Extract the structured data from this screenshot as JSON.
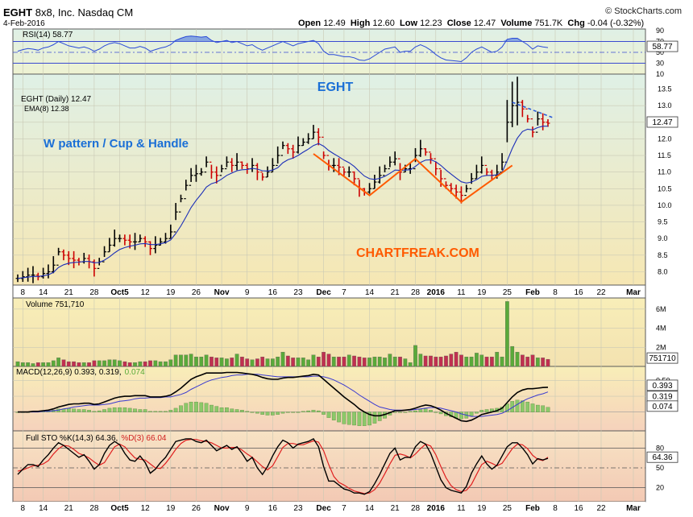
{
  "header": {
    "symbol": "EGHT",
    "company": "8x8, Inc.",
    "exchange": "Nasdaq CM",
    "date": "4-Feb-2016",
    "brand": "© StockCharts.com",
    "open_label": "Open",
    "open": "12.49",
    "high_label": "High",
    "high": "12.60",
    "low_label": "Low",
    "low": "12.23",
    "close_label": "Close",
    "close": "12.47",
    "volume_label": "Volume",
    "volume": "751.7K",
    "chg_label": "Chg",
    "chg": "-0.04 (-0.32%)"
  },
  "colors": {
    "up_bar": "#000000",
    "down_bar": "#cc0000",
    "ema": "#1c2fb8",
    "title_blue": "#1a6fd6",
    "annotation_orange": "#ff5a00",
    "volume_up": "#5aaa3a",
    "volume_down": "#c03050",
    "rsi_line": "#2a4ad8"
  },
  "x_axis_labels": [
    "8",
    "14",
    "21",
    "28",
    "Oct5",
    "12",
    "19",
    "26",
    "Nov",
    "9",
    "16",
    "23",
    "Dec",
    "7",
    "14",
    "21",
    "28",
    "2016",
    "11",
    "19",
    "25",
    "Feb",
    "8",
    "16",
    "22",
    "Mar"
  ],
  "annotations": {
    "chart_title": "EGHT",
    "pattern": "W pattern / Cup & Handle",
    "watermark": "CHARTFREAK.COM"
  },
  "panels": {
    "rsi": {
      "label": "RSI(14) 58.77",
      "value_tag": "58.77",
      "ticks": [
        "90",
        "70",
        "50",
        "30",
        "10"
      ]
    },
    "price": {
      "label": "EGHT (Daily) 12.47",
      "ema_label": "EMA(8) 12.38",
      "value_tag": "12.47",
      "ticks": [
        "13.5",
        "13.0",
        "12.5",
        "12.0",
        "11.5",
        "11.0",
        "10.5",
        "10.0",
        "9.5",
        "9.0",
        "8.5",
        "8.0"
      ]
    },
    "volume": {
      "label": "Volume 751,710",
      "value_tag": "751710",
      "ticks": [
        "6M",
        "4M",
        "2M"
      ]
    },
    "macd": {
      "label_main": "MACD(12,26,9) 0.393, 0.319,",
      "label_hist": "0.074",
      "tag1": "0.393",
      "tag2": "0.319",
      "tag3": "0.074",
      "ticks": [
        "0.50",
        "0.25"
      ]
    },
    "sto": {
      "label_k": "Full STO %K(14,3) 64.36,",
      "label_d": "%D(3) 66.04",
      "value_tag": "64.36",
      "ticks": [
        "80",
        "50",
        "20"
      ]
    }
  },
  "chart_data": {
    "type": "candlestick",
    "dates": [
      "2015-09-04",
      "2015-09-08",
      "2015-09-09",
      "2015-09-10",
      "2015-09-11",
      "2015-09-14",
      "2015-09-15",
      "2015-09-16",
      "2015-09-17",
      "2015-09-18",
      "2015-09-21",
      "2015-09-22",
      "2015-09-23",
      "2015-09-24",
      "2015-09-25",
      "2015-09-28",
      "2015-09-29",
      "2015-09-30",
      "2015-10-01",
      "2015-10-02",
      "2015-10-05",
      "2015-10-06",
      "2015-10-07",
      "2015-10-08",
      "2015-10-09",
      "2015-10-12",
      "2015-10-13",
      "2015-10-14",
      "2015-10-15",
      "2015-10-16",
      "2015-10-19",
      "2015-10-20",
      "2015-10-21",
      "2015-10-22",
      "2015-10-23",
      "2015-10-26",
      "2015-10-27",
      "2015-10-28",
      "2015-10-29",
      "2015-10-30",
      "2015-11-02",
      "2015-11-03",
      "2015-11-04",
      "2015-11-05",
      "2015-11-06",
      "2015-11-09",
      "2015-11-10",
      "2015-11-11",
      "2015-11-12",
      "2015-11-13",
      "2015-11-16",
      "2015-11-17",
      "2015-11-18",
      "2015-11-19",
      "2015-11-20",
      "2015-11-23",
      "2015-11-24",
      "2015-11-25",
      "2015-11-27",
      "2015-11-30",
      "2015-12-01",
      "2015-12-02",
      "2015-12-03",
      "2015-12-04",
      "2015-12-07",
      "2015-12-08",
      "2015-12-09",
      "2015-12-10",
      "2015-12-11",
      "2015-12-14",
      "2015-12-15",
      "2015-12-16",
      "2015-12-17",
      "2015-12-18",
      "2015-12-21",
      "2015-12-22",
      "2015-12-23",
      "2015-12-24",
      "2015-12-28",
      "2015-12-29",
      "2015-12-30",
      "2015-12-31",
      "2016-01-04",
      "2016-01-05",
      "2016-01-06",
      "2016-01-07",
      "2016-01-08",
      "2016-01-11",
      "2016-01-12",
      "2016-01-13",
      "2016-01-14",
      "2016-01-15",
      "2016-01-19",
      "2016-01-20",
      "2016-01-21",
      "2016-01-22",
      "2016-01-25",
      "2016-01-26",
      "2016-01-27",
      "2016-01-28",
      "2016-01-29",
      "2016-02-01",
      "2016-02-02",
      "2016-02-03",
      "2016-02-04"
    ],
    "close": [
      7.8,
      7.85,
      7.9,
      7.9,
      7.85,
      7.95,
      8.0,
      8.2,
      8.6,
      8.5,
      8.4,
      8.35,
      8.3,
      8.4,
      8.3,
      8.1,
      8.3,
      8.6,
      8.8,
      9.0,
      9.0,
      8.95,
      8.9,
      8.9,
      9.0,
      8.9,
      8.7,
      8.8,
      8.9,
      9.0,
      9.2,
      9.8,
      10.2,
      10.6,
      10.9,
      10.95,
      11.0,
      11.3,
      11.0,
      10.9,
      11.1,
      11.3,
      11.2,
      11.3,
      11.2,
      11.1,
      11.2,
      11.0,
      10.85,
      11.0,
      11.2,
      11.5,
      11.8,
      11.7,
      11.6,
      11.8,
      11.9,
      12.0,
      12.2,
      12.05,
      11.5,
      11.2,
      11.2,
      11.15,
      11.0,
      11.0,
      10.8,
      10.5,
      10.4,
      10.5,
      10.7,
      10.9,
      11.1,
      11.3,
      11.4,
      11.0,
      11.1,
      11.1,
      11.5,
      11.7,
      11.6,
      11.4,
      11.1,
      10.8,
      10.6,
      10.5,
      10.4,
      10.3,
      10.5,
      10.8,
      11.0,
      11.2,
      11.0,
      10.9,
      11.0,
      11.3,
      12.5,
      13.0,
      13.1,
      12.9,
      12.6,
      12.2,
      12.6,
      12.5,
      12.47
    ],
    "ema8": [
      7.8,
      7.82,
      7.84,
      7.86,
      7.86,
      7.88,
      7.91,
      7.98,
      8.13,
      8.21,
      8.26,
      8.28,
      8.29,
      8.31,
      8.31,
      8.27,
      8.28,
      8.35,
      8.45,
      8.57,
      8.67,
      8.73,
      8.77,
      8.8,
      8.84,
      8.85,
      8.82,
      8.82,
      8.84,
      8.88,
      8.96,
      9.15,
      9.38,
      9.65,
      9.93,
      10.15,
      10.34,
      10.55,
      10.65,
      10.7,
      10.79,
      10.9,
      10.97,
      11.04,
      11.07,
      11.08,
      11.11,
      11.09,
      11.04,
      11.03,
      11.06,
      11.13,
      11.28,
      11.37,
      11.42,
      11.5,
      11.6,
      11.69,
      11.8,
      11.86,
      11.78,
      11.65,
      11.55,
      11.46,
      11.36,
      11.28,
      11.17,
      11.02,
      10.88,
      10.8,
      10.78,
      10.81,
      10.87,
      10.96,
      11.06,
      11.05,
      11.06,
      11.07,
      11.17,
      11.29,
      11.36,
      11.37,
      11.31,
      11.2,
      11.06,
      10.94,
      10.82,
      10.71,
      10.67,
      10.7,
      10.77,
      10.87,
      10.9,
      10.9,
      10.92,
      11.0,
      11.34,
      11.71,
      12.02,
      12.22,
      12.29,
      12.27,
      12.34,
      12.38,
      12.38
    ],
    "volume": [
      0.5,
      0.4,
      0.4,
      0.3,
      0.4,
      0.4,
      0.4,
      0.6,
      0.9,
      0.7,
      0.5,
      0.5,
      0.4,
      0.4,
      0.4,
      0.6,
      0.6,
      0.6,
      0.7,
      0.7,
      0.6,
      0.5,
      0.4,
      0.4,
      0.5,
      0.5,
      0.6,
      0.6,
      0.5,
      0.5,
      0.7,
      1.2,
      1.2,
      1.2,
      1.3,
      1.0,
      1.0,
      1.2,
      1.0,
      0.9,
      0.9,
      0.8,
      0.9,
      1.3,
      1.0,
      0.8,
      0.7,
      0.8,
      1.0,
      0.8,
      0.8,
      1.0,
      1.5,
      1.1,
      0.9,
      0.9,
      0.9,
      0.7,
      1.2,
      1.0,
      1.5,
      1.3,
      1.0,
      1.0,
      1.0,
      1.2,
      1.1,
      1.0,
      0.9,
      0.9,
      1.0,
      1.0,
      0.9,
      1.3,
      1.0,
      1.0,
      0.8,
      0.4,
      2.2,
      1.3,
      1.1,
      1.1,
      1.0,
      1.0,
      1.1,
      1.3,
      1.5,
      1.2,
      1.0,
      1.0,
      1.4,
      1.2,
      1.0,
      1.0,
      1.5,
      1.0,
      6.8,
      2.1,
      1.5,
      1.2,
      1.0,
      1.2,
      0.9,
      0.9,
      0.75
    ],
    "macd": [
      0.0,
      0.0,
      0.0,
      0.01,
      0.01,
      0.02,
      0.03,
      0.05,
      0.08,
      0.1,
      0.12,
      0.13,
      0.13,
      0.14,
      0.14,
      0.12,
      0.13,
      0.16,
      0.19,
      0.22,
      0.24,
      0.25,
      0.25,
      0.26,
      0.26,
      0.26,
      0.24,
      0.24,
      0.24,
      0.25,
      0.27,
      0.32,
      0.38,
      0.45,
      0.52,
      0.56,
      0.59,
      0.62,
      0.62,
      0.62,
      0.62,
      0.63,
      0.63,
      0.63,
      0.62,
      0.61,
      0.6,
      0.58,
      0.55,
      0.53,
      0.52,
      0.52,
      0.54,
      0.55,
      0.55,
      0.56,
      0.57,
      0.58,
      0.6,
      0.59,
      0.52,
      0.45,
      0.38,
      0.31,
      0.24,
      0.18,
      0.12,
      0.05,
      0.0,
      -0.04,
      -0.06,
      -0.06,
      -0.04,
      -0.01,
      0.02,
      0.02,
      0.03,
      0.04,
      0.06,
      0.09,
      0.11,
      0.1,
      0.07,
      0.03,
      -0.02,
      -0.06,
      -0.1,
      -0.14,
      -0.15,
      -0.13,
      -0.09,
      -0.04,
      -0.02,
      0.0,
      0.02,
      0.06,
      0.15,
      0.24,
      0.31,
      0.35,
      0.37,
      0.37,
      0.38,
      0.39,
      0.393
    ],
    "signal": [
      0.0,
      0.0,
      0.0,
      0.0,
      0.0,
      0.01,
      0.01,
      0.02,
      0.03,
      0.05,
      0.06,
      0.08,
      0.09,
      0.1,
      0.11,
      0.11,
      0.11,
      0.12,
      0.13,
      0.15,
      0.17,
      0.18,
      0.19,
      0.21,
      0.22,
      0.22,
      0.23,
      0.23,
      0.23,
      0.24,
      0.24,
      0.26,
      0.28,
      0.31,
      0.36,
      0.4,
      0.44,
      0.48,
      0.51,
      0.53,
      0.55,
      0.56,
      0.58,
      0.59,
      0.59,
      0.6,
      0.6,
      0.6,
      0.59,
      0.58,
      0.57,
      0.56,
      0.56,
      0.56,
      0.56,
      0.56,
      0.56,
      0.56,
      0.57,
      0.57,
      0.56,
      0.54,
      0.51,
      0.47,
      0.43,
      0.38,
      0.33,
      0.27,
      0.22,
      0.17,
      0.12,
      0.08,
      0.06,
      0.04,
      0.03,
      0.03,
      0.03,
      0.03,
      0.04,
      0.05,
      0.06,
      0.07,
      0.07,
      0.06,
      0.04,
      0.02,
      0.0,
      -0.03,
      -0.05,
      -0.07,
      -0.07,
      -0.07,
      -0.06,
      -0.05,
      -0.04,
      -0.02,
      0.02,
      0.07,
      0.12,
      0.17,
      0.21,
      0.24,
      0.27,
      0.29,
      0.319
    ],
    "sto_k": [
      40,
      48,
      55,
      55,
      52,
      62,
      70,
      80,
      88,
      84,
      78,
      72,
      66,
      70,
      60,
      48,
      55,
      72,
      84,
      90,
      85,
      72,
      62,
      60,
      68,
      58,
      42,
      48,
      58,
      66,
      78,
      90,
      92,
      94,
      94,
      90,
      88,
      92,
      84,
      76,
      80,
      84,
      78,
      82,
      72,
      60,
      66,
      50,
      40,
      52,
      68,
      82,
      92,
      88,
      80,
      86,
      88,
      90,
      94,
      82,
      52,
      30,
      30,
      24,
      18,
      16,
      12,
      12,
      10,
      14,
      26,
      40,
      56,
      72,
      80,
      62,
      66,
      66,
      82,
      90,
      86,
      72,
      52,
      32,
      20,
      16,
      14,
      12,
      22,
      42,
      56,
      68,
      56,
      48,
      54,
      68,
      82,
      88,
      88,
      80,
      70,
      56,
      64,
      62,
      64.36
    ],
    "sto_d": [
      45,
      47,
      50,
      53,
      54,
      56,
      61,
      71,
      79,
      84,
      83,
      78,
      72,
      69,
      65,
      59,
      54,
      58,
      70,
      82,
      86,
      82,
      73,
      65,
      63,
      62,
      56,
      50,
      49,
      57,
      67,
      78,
      87,
      92,
      93,
      93,
      91,
      90,
      88,
      84,
      80,
      80,
      81,
      81,
      77,
      71,
      66,
      59,
      52,
      47,
      53,
      67,
      81,
      87,
      87,
      85,
      85,
      88,
      91,
      89,
      76,
      55,
      37,
      28,
      24,
      19,
      15,
      13,
      11,
      12,
      17,
      27,
      41,
      56,
      69,
      71,
      69,
      65,
      71,
      79,
      86,
      83,
      70,
      52,
      35,
      23,
      17,
      14,
      16,
      25,
      40,
      55,
      60,
      57,
      53,
      57,
      68,
      79,
      86,
      85,
      79,
      69,
      63,
      61,
      66.04
    ],
    "rsi": [
      52,
      55,
      57,
      56,
      54,
      58,
      60,
      64,
      70,
      66,
      62,
      60,
      58,
      60,
      57,
      52,
      56,
      62,
      66,
      68,
      66,
      62,
      58,
      58,
      61,
      58,
      52,
      55,
      58,
      60,
      64,
      72,
      76,
      79,
      80,
      79,
      78,
      79,
      72,
      68,
      70,
      72,
      68,
      70,
      66,
      62,
      64,
      58,
      54,
      58,
      62,
      66,
      70,
      66,
      62,
      66,
      68,
      70,
      72,
      66,
      52,
      46,
      46,
      44,
      42,
      42,
      40,
      36,
      35,
      38,
      44,
      50,
      56,
      58,
      60,
      50,
      52,
      52,
      60,
      64,
      60,
      54,
      46,
      40,
      36,
      35,
      34,
      33,
      40,
      50,
      56,
      60,
      55,
      50,
      52,
      60,
      74,
      76,
      76,
      70,
      64,
      56,
      62,
      60,
      58.77
    ],
    "xlabel": "",
    "ylabel": "",
    "price_ylim": [
      7.6,
      13.9
    ],
    "volume_ylim": [
      0,
      7
    ],
    "macd_ylim": [
      -0.3,
      0.7
    ],
    "sto_ylim": [
      0,
      100
    ],
    "rsi_ylim": [
      10,
      90
    ],
    "legend": "top-left",
    "grid": true
  }
}
